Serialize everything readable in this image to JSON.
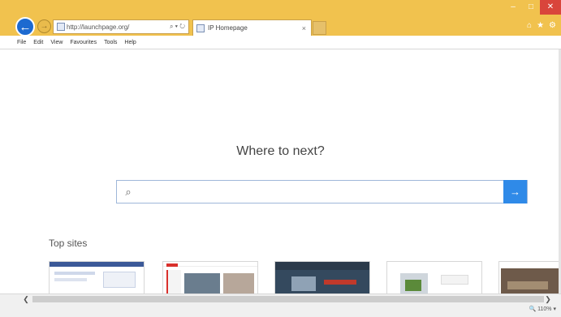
{
  "browser": {
    "address_url": "http://launchpage.org/",
    "address_controls": "⌕ ▾ ↻",
    "tab_title": "IP Homepage",
    "tab_close": "×",
    "window_controls": [
      "–",
      "□",
      "✕"
    ],
    "toolbar_icons": [
      "⌂",
      "★",
      "⚙"
    ]
  },
  "menu": [
    "File",
    "Edit",
    "View",
    "Favourites",
    "Tools",
    "Help"
  ],
  "page": {
    "heading": "Where to next?",
    "search_value": "",
    "search_go_glyph": "→",
    "search_glyph": "⌕",
    "top_sites_label": "Top sites"
  },
  "scrollbar": {
    "left": "❮",
    "right": "❯"
  },
  "status": {
    "zoom": "🔍 110%  ▾"
  },
  "colors": {
    "titlebar": "#f1c24e",
    "accent": "#2f8ae8",
    "back_button": "#1d6ad0",
    "close_button": "#d9453b"
  }
}
